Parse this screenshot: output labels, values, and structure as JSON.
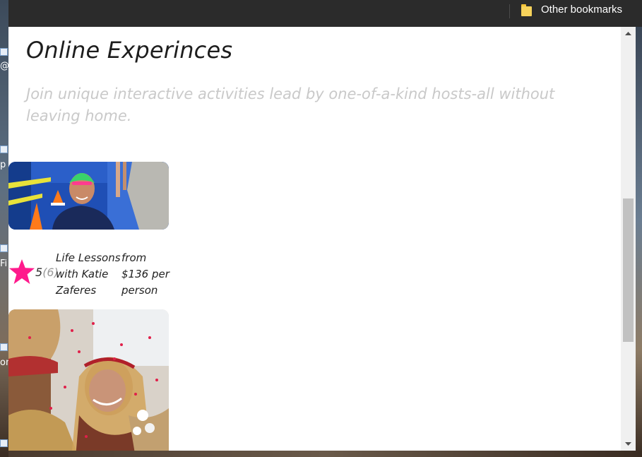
{
  "bookmarks_bar": {
    "other_bookmarks_label": "Other bookmarks",
    "folder_icon": "folder-icon"
  },
  "page": {
    "title": "Online Experinces",
    "subtitle": "Join unique interactive activities lead by one-of-a-kind hosts-all without leaving home."
  },
  "experiences": [
    {
      "image": "swimmer-photo",
      "rating": "5",
      "review_count": "(6)",
      "title": "Life Lessons with Katie Zaferes",
      "price": "from $136 per person",
      "star_icon": "star-icon",
      "star_color": "#ff1a8c"
    },
    {
      "image": "wedding-photo"
    }
  ],
  "desktop_fragments": [
    "@",
    "p",
    "Fi",
    "on"
  ],
  "colors": {
    "bookmarks_bar": "#2b2b2b",
    "accent_star": "#ff1a8c",
    "subtitle": "#c9c9c9",
    "scroll_thumb": "#c1c1c1"
  }
}
